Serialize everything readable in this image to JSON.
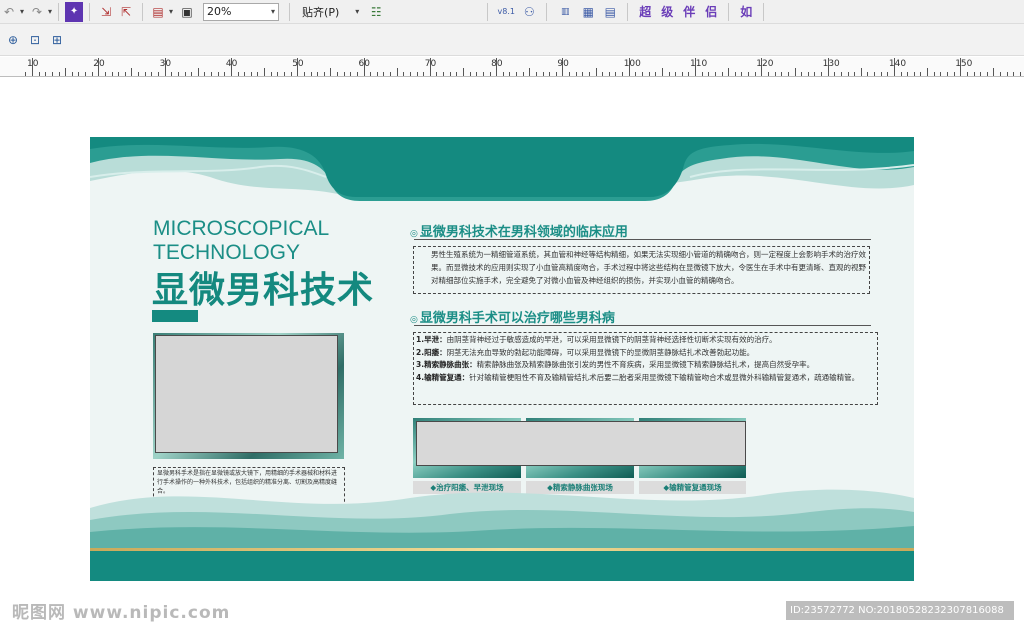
{
  "toolbar": {
    "zoom_value": "20%",
    "snap_label": "贴齐(P)",
    "version_label": "v8.1",
    "right_icons": [
      "超",
      "级",
      "伴",
      "侣",
      "如"
    ]
  },
  "ruler": {
    "labels": [
      "10",
      "20",
      "30",
      "40",
      "50",
      "60",
      "70",
      "80",
      "90",
      "100",
      "110",
      "120",
      "130",
      "140",
      "150"
    ]
  },
  "board": {
    "en_line1": "MICROSCOPICAL",
    "en_line2": "TECHNOLOGY",
    "cn_title": "显微男科技术",
    "left_desc": "显微男科手术是指在显微镜或放大镜下，用精细的手术器械和材料进行手术操作的一种外科技术，包括组织的精准分离、切割及高精度缝合。",
    "section1": {
      "title": "显微男科技术在男科领域的临床应用",
      "para": "男性生殖系统为一精细管道系统，其血管和神经等结构精细，如果无法实现细小管道的精确吻合，则一定程度上会影响手术的治疗效果。而显微技术的应用则实现了小血管高精度吻合，手术过程中将这些结构在显微镜下放大，令医生在手术中有更清晰、直观的视野对精细部位实施手术，完全避免了对微小血管及神经组织的损伤，并实现小血管的精确吻合。"
    },
    "section2": {
      "title": "显微男科手术可以治疗哪些男科病",
      "items": [
        {
          "label": "1.早泄：",
          "text": "由阴茎背神经过于敏感造成的早泄，可以采用显微镜下的阴茎背神经选择性切断术实现有效的治疗。"
        },
        {
          "label": "2.阳痿：",
          "text": "阴茎无法充血导致的勃起功能障碍，可以采用显微镜下的显微阴茎静脉结扎术改善勃起功能。"
        },
        {
          "label": "3.精索静脉曲张：",
          "text": "精索静脉曲张及精索静脉曲张引发的男性不育疾病，采用显微镜下精索静脉结扎术，提高自然受孕率。"
        },
        {
          "label": "4.输精管复通：",
          "text": "针对输精管梗阻性不育及输精管结扎术后要二胎者采用显微镜下输精管吻合术或显微外科输精管复通术，疏通输精管。"
        }
      ]
    },
    "captions": [
      "◆治疗阳痿、早泄现场",
      "◆精索静脉曲张现场",
      "◆输精管复通现场"
    ]
  },
  "watermark": "昵图网 www.nipic.com",
  "image_id": "ID:23572772 NO:20180528232307816088",
  "colors": {
    "teal": "#148a80",
    "teal_text": "#1b8e86",
    "board_bg": "#eef5f4",
    "gold": "#c9a95a"
  }
}
